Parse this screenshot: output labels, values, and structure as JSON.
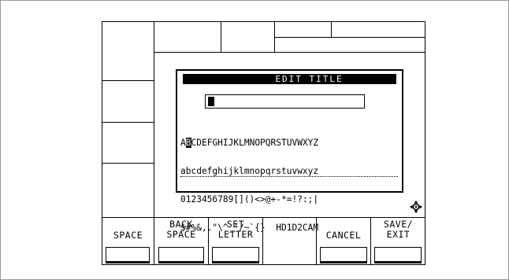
{
  "dialog": {
    "title": "EDIT TITLE",
    "charset": {
      "row1_before": "A",
      "row1_selected": "B",
      "row1_after": "CDEFGHIJKLMNOPQRSTUVWXYZ",
      "row2": "abcdefghijklmnopqrstuvwxyz",
      "row3": "0123456789[]()<>@+-*=!?:;|",
      "row4": "$#%&,.\"\\^_'/~`{}  HD1D2CAM"
    }
  },
  "softkeys": {
    "space": "SPACE",
    "backspace_line1": "BACK",
    "backspace_line2": "SPACE",
    "set_letter_line1": "SET",
    "set_letter_line2": "LETTER",
    "cancel": "CANCEL",
    "save_exit_line1": "SAVE/",
    "save_exit_line2": "EXIT"
  },
  "icons": {
    "move": "four-way-move-icon"
  },
  "colors": {
    "ink": "#000000",
    "background": "#ffffff"
  }
}
